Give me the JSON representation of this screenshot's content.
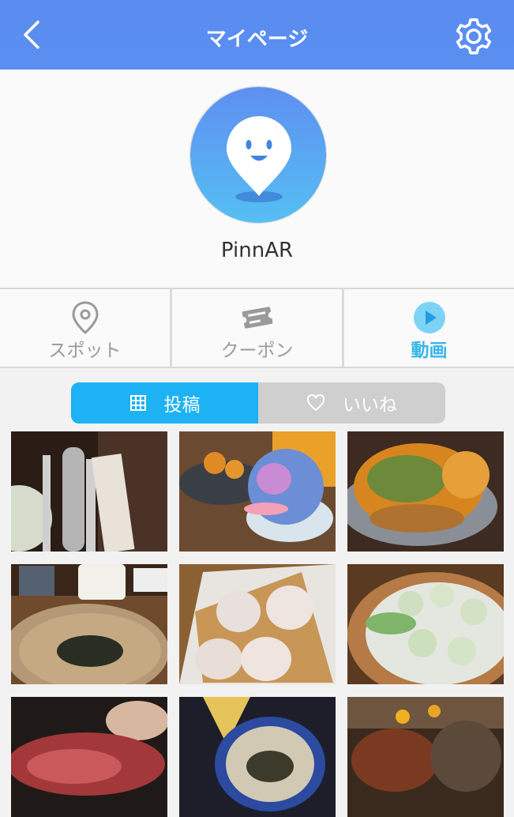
{
  "header": {
    "title": "マイページ"
  },
  "profile": {
    "username": "PinnAR"
  },
  "tabs": [
    {
      "label": "スポット",
      "icon": "location-pin-icon",
      "active": false
    },
    {
      "label": "クーポン",
      "icon": "ticket-icon",
      "active": false
    },
    {
      "label": "動画",
      "icon": "play-icon",
      "active": true
    }
  ],
  "segment": {
    "posts_label": "投稿",
    "likes_label": "いいね",
    "selected": "posts"
  },
  "colors": {
    "header": "#5b8cf0",
    "accent": "#38b6ea",
    "segment_active": "#1cb2f3",
    "segment_inactive": "#cfcfcf"
  },
  "photos": [
    "soba-dish",
    "shaved-ice-dessert",
    "pumpkin-dish",
    "zaru-soba",
    "xiaolongbao-plate",
    "steamer-dumplings",
    "pizza",
    "noodle-bowl",
    "flower-arrangement"
  ]
}
